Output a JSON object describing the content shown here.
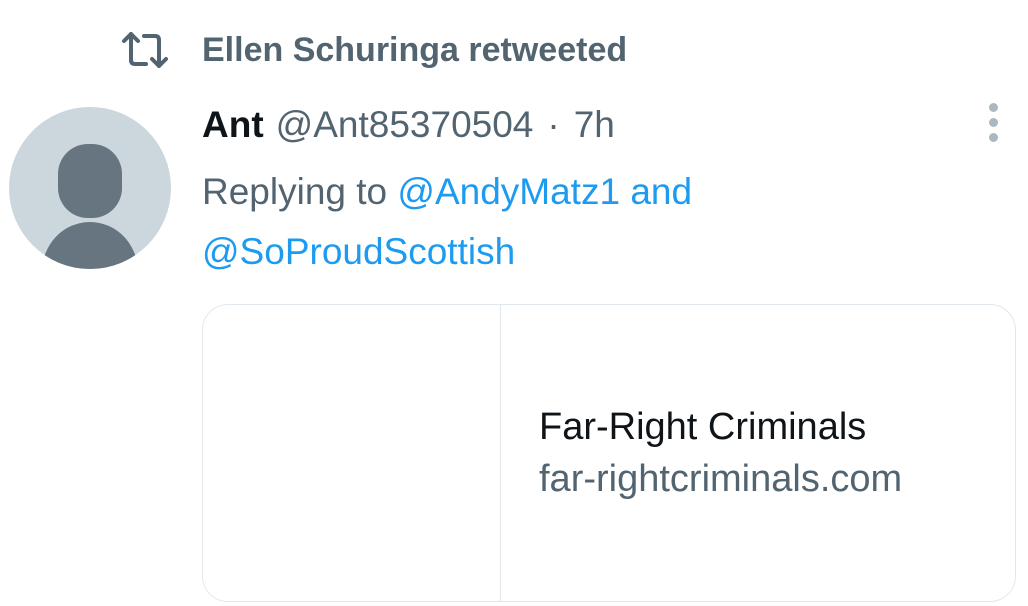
{
  "retweet": {
    "icon": "retweet-icon",
    "text": "Ellen Schuringa retweeted"
  },
  "tweet": {
    "avatar_icon": "default-profile-icon",
    "display_name": "Ant",
    "handle": "@Ant85370504",
    "separator": "·",
    "time": "7h",
    "more_icon": "more-vertical-icon",
    "reply": {
      "prefix": "Replying to",
      "mention_1": "@AndyMatz1",
      "conjunction": "and",
      "mention_2": "@SoProudScottish"
    },
    "card": {
      "title": "Far-Right Criminals",
      "domain": "far-rightcriminals.com"
    }
  },
  "colors": {
    "secondary_text": "#536471",
    "link": "#1d9bf0",
    "primary_text": "#0f1419",
    "avatar_bg": "#ccd6dd",
    "avatar_fg": "#66757f",
    "border": "#e1e8ed"
  }
}
